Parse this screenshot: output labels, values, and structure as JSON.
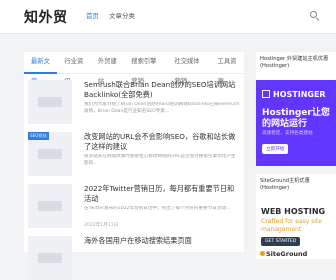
{
  "header": {
    "logo": "知外贸",
    "nav": [
      {
        "label": "首页",
        "active": true
      },
      {
        "label": "文章分类",
        "active": false
      }
    ]
  },
  "tabs": [
    {
      "label": "最新文章",
      "active": true
    },
    {
      "label": "行业资讯",
      "active": false
    },
    {
      "label": "外贸建站",
      "active": false
    },
    {
      "label": "搜索引擎营销",
      "active": false
    },
    {
      "label": "社交媒体营销",
      "active": false
    },
    {
      "label": "工具资源",
      "active": false
    }
  ],
  "articles": [
    {
      "badge": "",
      "title": "Semrush联合Brian Dean创办的SEO培训网站Backlinko(全部免费)",
      "excerpt": "我们为大家介绍了Brian Dean创办的SEO培训网站Backlinko已被Semrush收购，Brian Dean是行业知名SEO专家…",
      "date": ""
    },
    {
      "badge": "SEO优化",
      "title": "改变网站的URL会不会影响SEO，谷歌和站长做了这样的建议",
      "excerpt": "很多站长在网站改版时都会担心修改网站的URL是否会对搜索引擎优化产生影响…",
      "date": ""
    },
    {
      "badge": "",
      "title": "2022年Twitter营销日历，每月都有重要节日和活动",
      "excerpt": "在Twitter发布的2022年营销日历中，列出了每个月份的重要节日活动…",
      "date": "2022年1月11日"
    },
    {
      "badge": "",
      "title": "海外各国用户在移动搜索结果页面",
      "excerpt": "",
      "date": ""
    }
  ],
  "sidebar": {
    "ad1_title": "Hostinger 外贸建站主机优惠(Hostinger)",
    "hostinger": {
      "logo": "HOSTINGER",
      "headline": "Hostinger让您的网站运行",
      "sub": "高速稳定，支持各类建站",
      "button": "立即开始"
    },
    "ad2_title": "SiteGround主机优惠(Hostinger)",
    "siteground": {
      "headline": "WEB HOSTING",
      "sub": "Crafted for easy site management",
      "button": "GET STARTED",
      "logo": "SiteGround"
    }
  },
  "colors": {
    "accent": "#2f7de1",
    "hostinger": "#6236ff",
    "siteground": "#f39c12"
  }
}
